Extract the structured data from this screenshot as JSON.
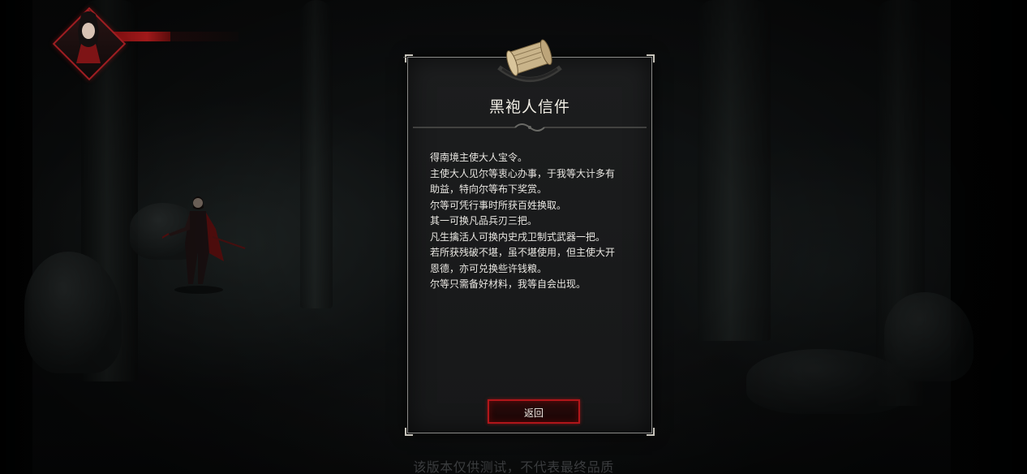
{
  "hud": {
    "health_fraction": 0.46,
    "health_color": "#a0191a",
    "portrait_frame_color": "#9e1e22"
  },
  "letter": {
    "title": "黑袍人信件",
    "lines": [
      "得南境主使大人宝令。",
      "主使大人见尔等衷心办事，于我等大计多有",
      "助益，特向尔等布下奖赏。",
      "尔等可凭行事时所获百姓换取。",
      "其一可换凡品兵刃三把。",
      "凡生擒活人可换内史戌卫制式武器一把。",
      "若所获残破不堪，虽不堪使用，但主使大开",
      "恩德，亦可兑换些许钱粮。",
      "尔等只需备好材料，我等自会出现。"
    ],
    "return_label": "返回",
    "button_border_color": "#b0161a"
  },
  "footer": {
    "notice": "该版本仅供测试，不代表最终品质"
  },
  "icons": {
    "scroll": "scroll-icon",
    "divider": "ornament-divider-icon"
  }
}
